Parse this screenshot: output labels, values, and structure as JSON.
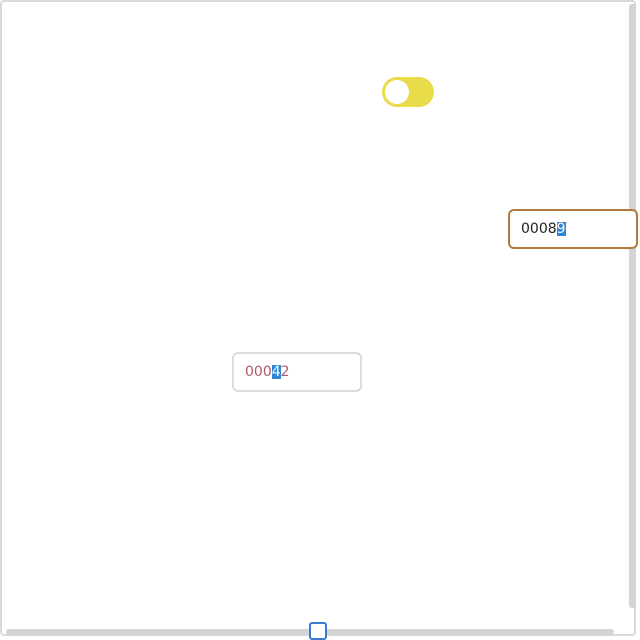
{
  "toggle": {
    "state": "on",
    "color": "#e8dc4a"
  },
  "field_top": {
    "text_before": "0008",
    "text_selected": "9",
    "text_after": "",
    "border_color": "#b07a3c"
  },
  "field_bottom": {
    "text_before": "000",
    "text_selected": "4",
    "text_after": "2",
    "text_color": "#b05a6a"
  },
  "selection_color": "#2f86d6"
}
